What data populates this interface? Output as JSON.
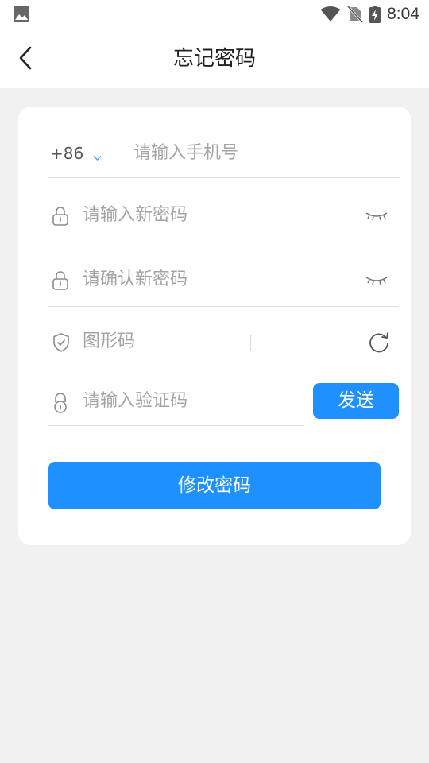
{
  "status_bar": {
    "time": "8:04",
    "icons": [
      "image-notification-icon",
      "wifi-icon",
      "no-sim-icon",
      "battery-charging-icon"
    ]
  },
  "header": {
    "title": "忘记密码",
    "back_icon": "chevron-left-icon"
  },
  "form": {
    "phone": {
      "country_code": "+86",
      "placeholder": "请输入手机号"
    },
    "new_password": {
      "placeholder": "请输入新密码",
      "icon": "lock-icon",
      "toggle_icon": "eye-closed-icon"
    },
    "confirm_password": {
      "placeholder": "请确认新密码",
      "icon": "lock-icon",
      "toggle_icon": "eye-closed-icon"
    },
    "captcha": {
      "placeholder": "图形码",
      "icon": "shield-check-icon",
      "refresh_icon": "refresh-icon"
    },
    "verification_code": {
      "placeholder": "请输入验证码",
      "icon": "lock-icon",
      "send_label": "发送"
    },
    "submit_label": "修改密码"
  },
  "colors": {
    "accent": "#1e90ff",
    "background": "#f1f1f1",
    "card": "#ffffff",
    "placeholder_text": "#a4a4a4",
    "divider": "#dcdcdc"
  }
}
